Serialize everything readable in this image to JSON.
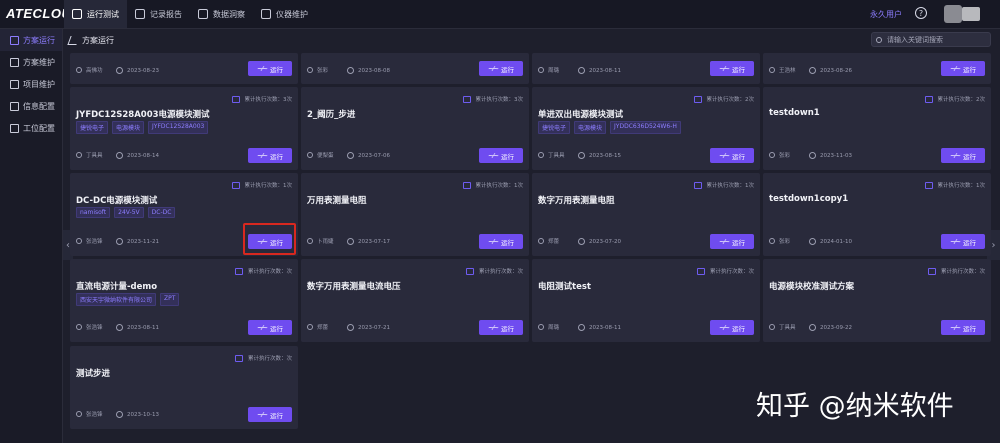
{
  "app": {
    "logo": "ATECLOUD"
  },
  "nav": {
    "tabs": [
      {
        "label": "运行测试"
      },
      {
        "label": "记录报告"
      },
      {
        "label": "数据洞察"
      },
      {
        "label": "仪器维护"
      }
    ]
  },
  "user": {
    "name": "永久用户",
    "help": "?"
  },
  "sidebar": {
    "items": [
      {
        "label": "方案运行"
      },
      {
        "label": "方案维护"
      },
      {
        "label": "项目维护"
      },
      {
        "label": "信息配置"
      },
      {
        "label": "工位配置"
      }
    ]
  },
  "breadcrumb": {
    "label": "方案运行"
  },
  "search": {
    "placeholder": "请输入关键词搜索"
  },
  "run_label": "运行",
  "cards": [
    {
      "author": "高佛功",
      "date": "2023-08-23"
    },
    {
      "author": "张彩",
      "date": "2023-08-08"
    },
    {
      "author": "周璐",
      "date": "2023-08-11"
    },
    {
      "author": "王浩林",
      "date": "2023-08-26"
    },
    {
      "title": "JYFDC12S28A003电源模块测试",
      "tags": [
        "捷锐电子",
        "电源模块",
        "JYFDC12S28A003"
      ],
      "counter": "累计执行次数：3次",
      "author": "丁具具",
      "date": "2023-08-14"
    },
    {
      "title": "2_阈历_步进",
      "tags": [],
      "counter": "累计执行次数：3次",
      "author": "便梨蛋",
      "date": "2023-07-06"
    },
    {
      "title": "单进双出电源模块测试",
      "tags": [
        "捷锐电子",
        "电源模块",
        "JYDDC636D524W6-H"
      ],
      "counter": "累计执行次数：2次",
      "author": "丁具具",
      "date": "2023-08-15"
    },
    {
      "title": "testdown1",
      "tags": [],
      "counter": "累计执行次数：2次",
      "author": "张彩",
      "date": "2023-11-03"
    },
    {
      "title": "DC-DC电源模块测试",
      "tags": [
        "namisoft",
        "24V-5V",
        "DC-DC"
      ],
      "counter": "累计执行次数：1次",
      "author": "张浩锋",
      "date": "2023-11-21"
    },
    {
      "title": "万用表测量电阻",
      "tags": [],
      "counter": "累计执行次数：1次",
      "author": "卜雨婕",
      "date": "2023-07-17"
    },
    {
      "title": "数字万用表测量电阻",
      "tags": [],
      "counter": "累计执行次数：1次",
      "author": "郑蕾",
      "date": "2023-07-20"
    },
    {
      "title": "testdown1copy1",
      "tags": [],
      "counter": "累计执行次数：1次",
      "author": "张彩",
      "date": "2024-01-10"
    },
    {
      "title": "直流电源计量-demo",
      "tags": [
        "西安天宇微纳软件有限公司",
        "ZPT"
      ],
      "counter": "累计执行次数：次",
      "author": "张浩锋",
      "date": "2023-08-11"
    },
    {
      "title": "数字万用表测量电流电压",
      "tags": [],
      "counter": "累计执行次数：次",
      "author": "郑蕾",
      "date": "2023-07-21"
    },
    {
      "title": "电阻测试test",
      "tags": [],
      "counter": "累计执行次数：次",
      "author": "周璐",
      "date": "2023-08-11"
    },
    {
      "title": "电源模块校准测试方案",
      "tags": [],
      "counter": "累计执行次数：次",
      "author": "丁具具",
      "date": "2023-09-22"
    },
    {
      "title": "测试步进",
      "tags": [],
      "counter": "累计执行次数：次",
      "author": "张浩锋",
      "date": "2023-10-13"
    }
  ],
  "watermark": "知乎 @纳米软件"
}
